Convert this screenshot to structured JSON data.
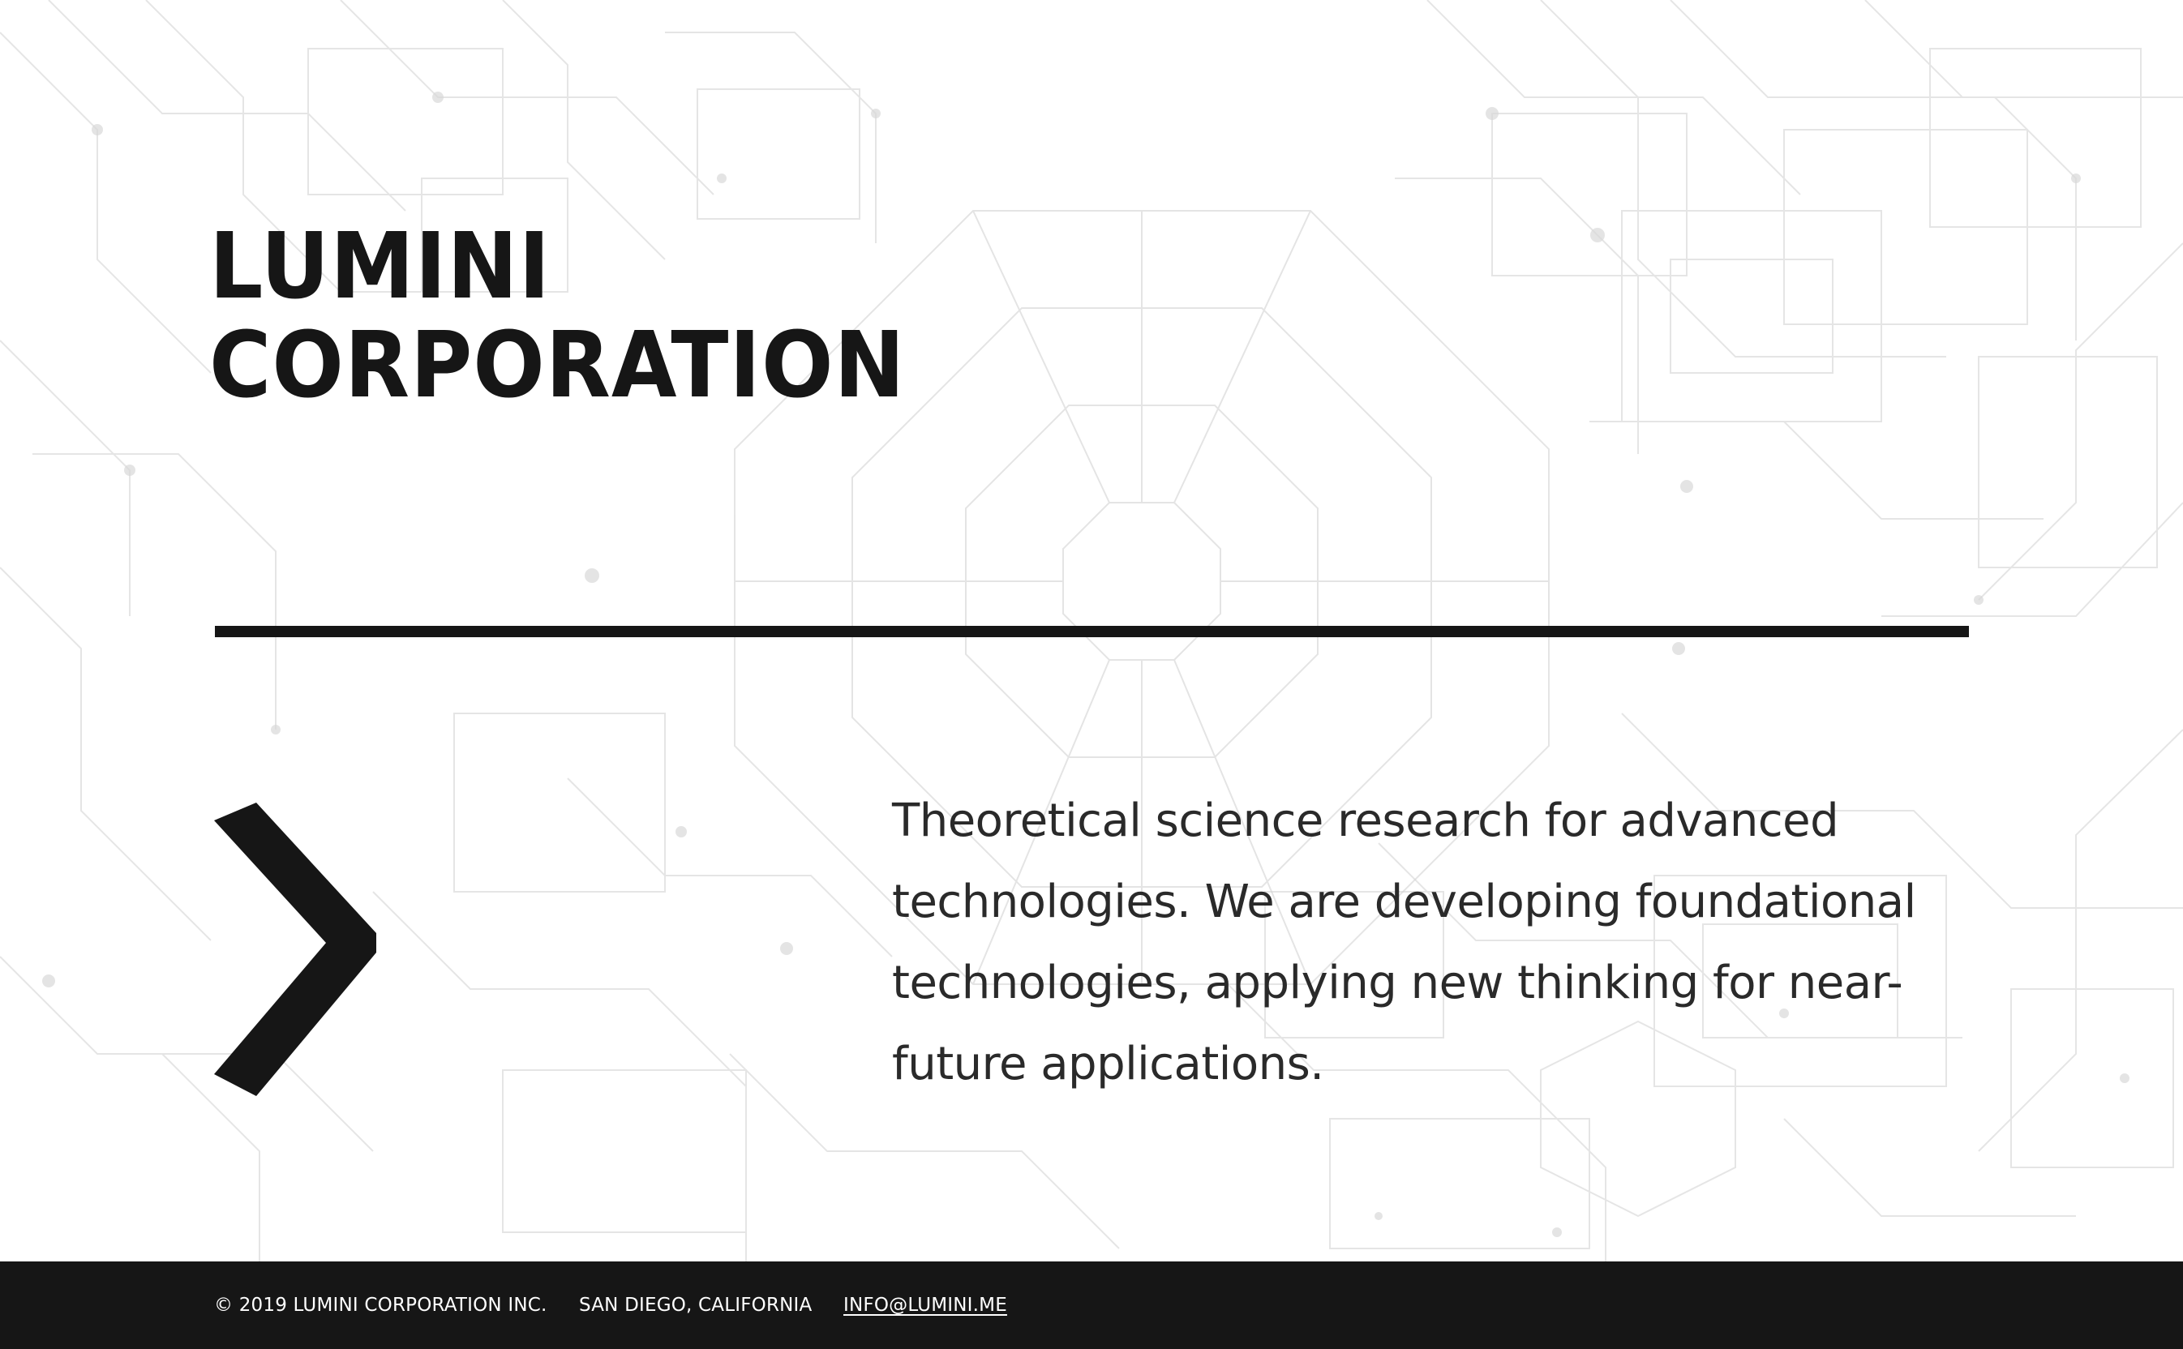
{
  "brand": {
    "line1": "LUMINI",
    "line2": "CORPORATION"
  },
  "tagline": "Theoretical science research for advanced technologies. We are developing foundational technologies, applying new thinking for near-future applications.",
  "footer": {
    "copyright": "© 2019 LUMINI CORPORATION INC.",
    "location": "SAN DIEGO, CALIFORNIA",
    "email": "INFO@LUMINI.ME"
  },
  "colors": {
    "text": "#161616",
    "footer_background": "#161616",
    "footer_text": "#ffffff",
    "background": "#ffffff",
    "pattern_lines": "#d6d6d6"
  },
  "icons": {
    "arrow": "chevron-right-icon",
    "background": "circuit-pattern"
  }
}
